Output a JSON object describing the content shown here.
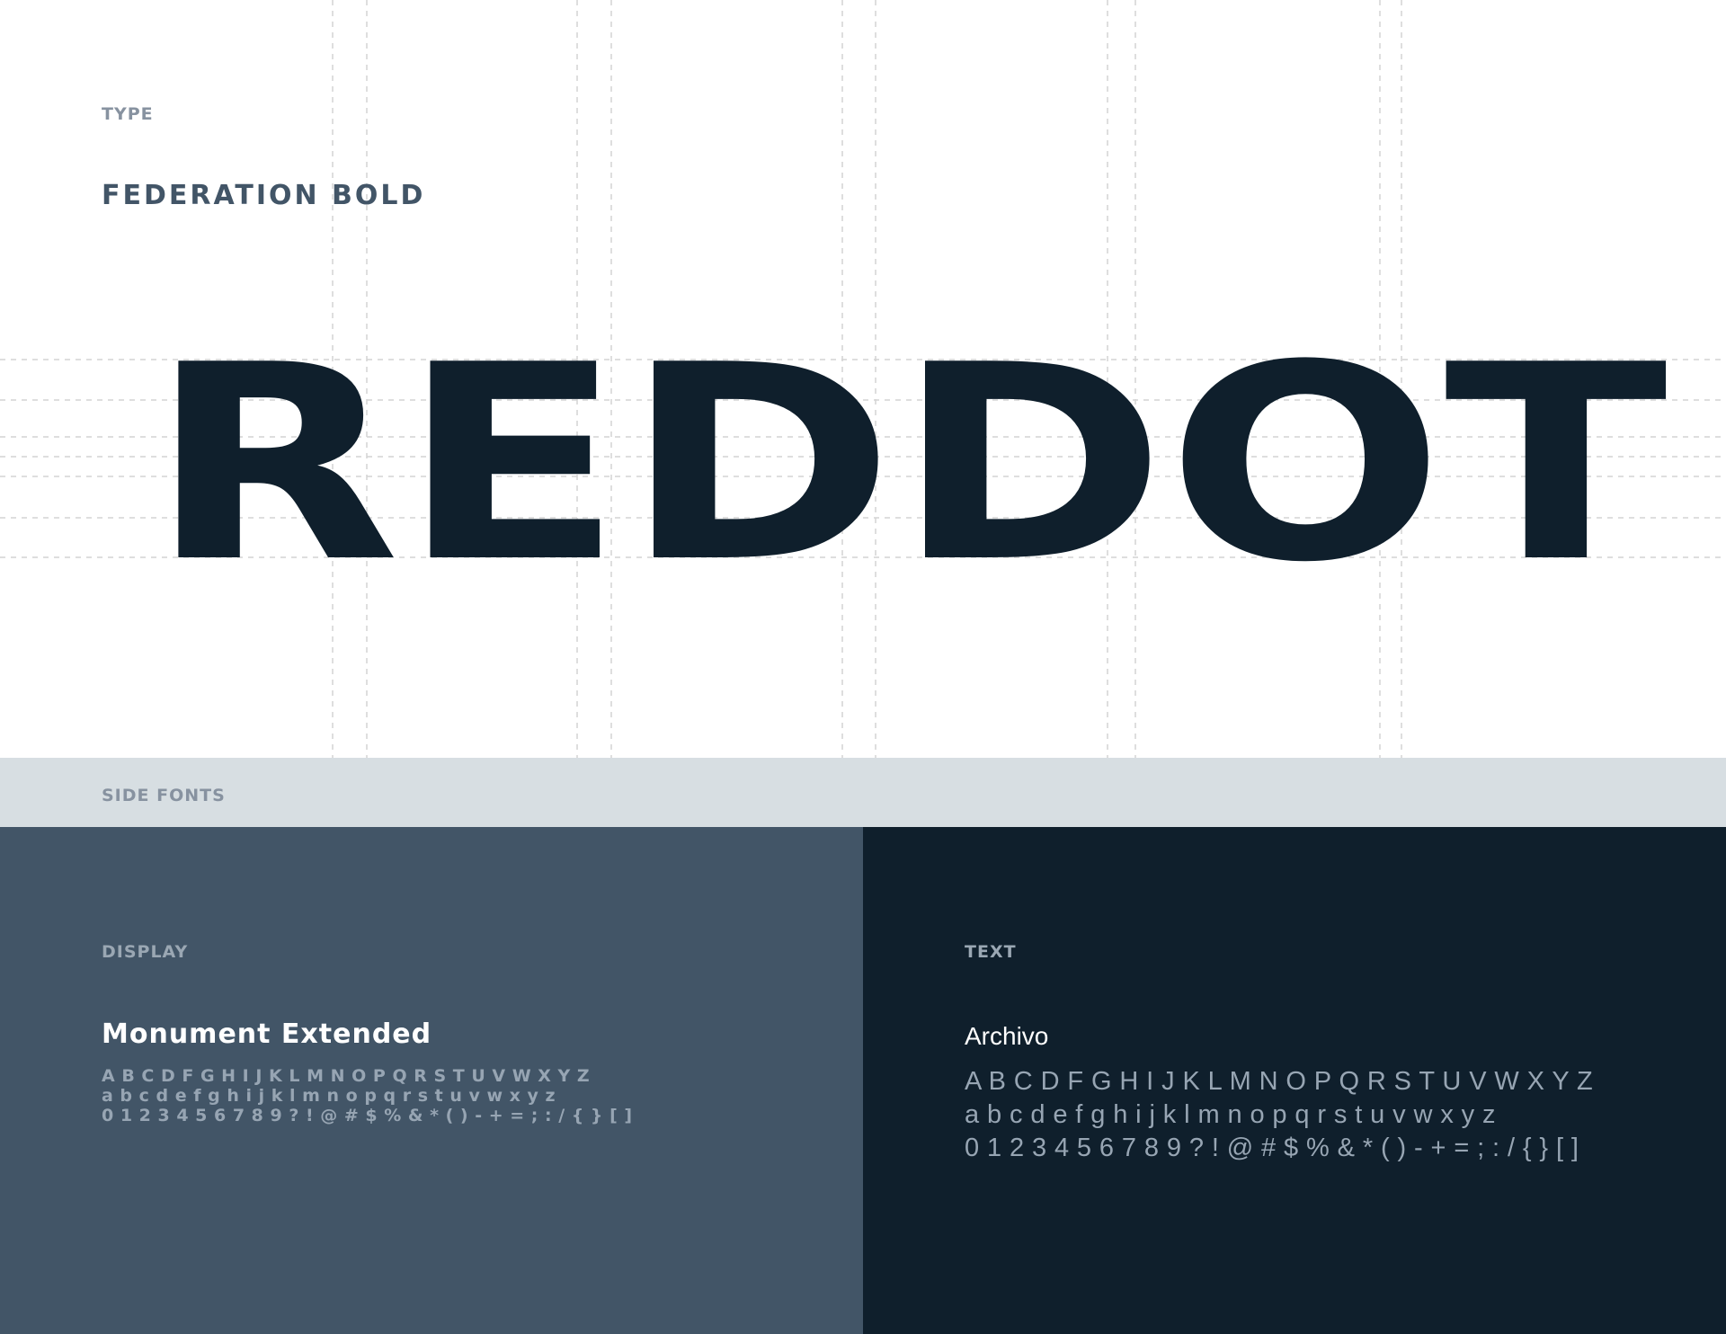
{
  "type_section": {
    "label": "TYPE",
    "font_name": "FEDERATION BOLD",
    "wordmark": "REDDOT",
    "wordmark_color": "#0f1f2c",
    "grid_color": "#d3d3d3"
  },
  "side_fonts": {
    "label": "SIDE FONTS",
    "band_color": "#d7dee2"
  },
  "display": {
    "label": "DISPLAY",
    "font_name": "Monument Extended",
    "panel_color": "#425567",
    "glyph_rows": [
      "A B C D F G H I J K L M N O P Q R S T U V W X Y Z",
      "a b c d e f g h i j k l m n o p q r s t u v w x y z",
      "0 1 2 3 4 5 6 7 8 9 ? ! @ # $ % & * ( ) - + = ; : / { } [ ]"
    ]
  },
  "text": {
    "label": "TEXT",
    "font_name": "Archivo",
    "panel_color": "#0f1f2c",
    "glyph_rows": [
      "A B C D F G H I J K L M N O P Q R S T U V W X Y Z",
      "a b c d e f g h i j k l m n o p q r s t u v w x y z",
      "0 1 2 3 4 5 6 7 8 9 ? ! @ # $ % & * ( ) - + = ; : / { } [ ]"
    ]
  }
}
